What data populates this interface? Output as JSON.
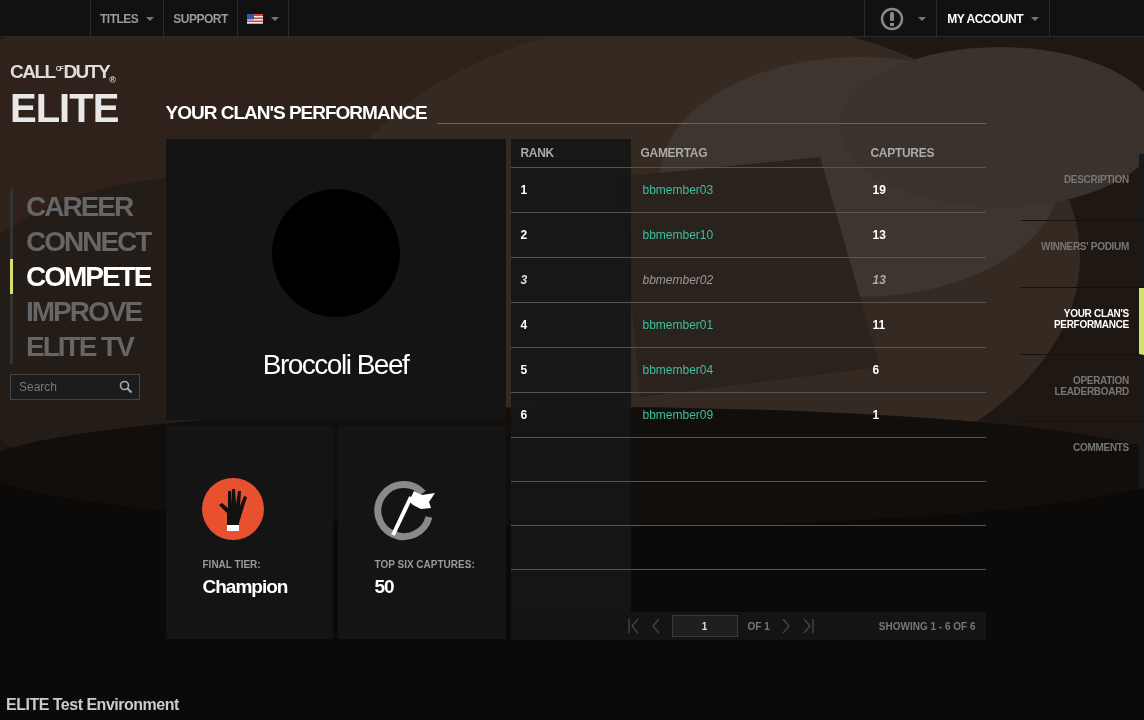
{
  "top_nav": {
    "items": [
      {
        "label": "TITLES",
        "dropdown": true
      },
      {
        "label": "SUPPORT",
        "dropdown": false
      }
    ],
    "account": "MY ACCOUNT"
  },
  "logo": {
    "top": "CALL",
    "of": "OF",
    "duty": "DUTY",
    "mark": "®",
    "bottom": "ELITE"
  },
  "side_nav": [
    {
      "label": "CAREER",
      "selected": false
    },
    {
      "label": "CONNECT",
      "selected": false
    },
    {
      "label": "COMPETE",
      "selected": true
    },
    {
      "label": "IMPROVE",
      "selected": false
    },
    {
      "label": "ELITE TV",
      "selected": false
    }
  ],
  "search": {
    "placeholder": "Search"
  },
  "section_title": "YOUR CLAN'S PERFORMANCE",
  "clan": {
    "name": "Broccoli Beef"
  },
  "stats": [
    {
      "kind": "tier",
      "label": "FINAL TIER:",
      "value": "Champion"
    },
    {
      "kind": "captures",
      "label": "TOP SIX CAPTURES:",
      "value": "50"
    }
  ],
  "table": {
    "columns": [
      "RANK",
      "GAMERTAG",
      "CAPTURES"
    ],
    "rows": [
      {
        "rank": "1",
        "gamertag": "bbmember03",
        "captures": "19",
        "muted": false
      },
      {
        "rank": "2",
        "gamertag": "bbmember10",
        "captures": "13",
        "muted": false
      },
      {
        "rank": "3",
        "gamertag": "bbmember02",
        "captures": "13",
        "muted": true
      },
      {
        "rank": "4",
        "gamertag": "bbmember01",
        "captures": "11",
        "muted": false
      },
      {
        "rank": "5",
        "gamertag": "bbmember04",
        "captures": "6",
        "muted": false
      },
      {
        "rank": "6",
        "gamertag": "bbmember09",
        "captures": "1",
        "muted": false
      }
    ]
  },
  "pagination": {
    "page": "1",
    "of": "OF 1",
    "showing": "SHOWING 1 - 6 OF 6"
  },
  "right_tabs": [
    {
      "label": "DESCRIPTION",
      "selected": false
    },
    {
      "label": "WINNERS' PODIUM",
      "selected": false
    },
    {
      "label": "YOUR CLAN'S PERFORMANCE",
      "selected": true
    },
    {
      "label": "OPERATION LEADERBOARD",
      "selected": false
    },
    {
      "label": "COMMENTS",
      "selected": false
    }
  ],
  "footer": "ELITE Test Environment"
}
